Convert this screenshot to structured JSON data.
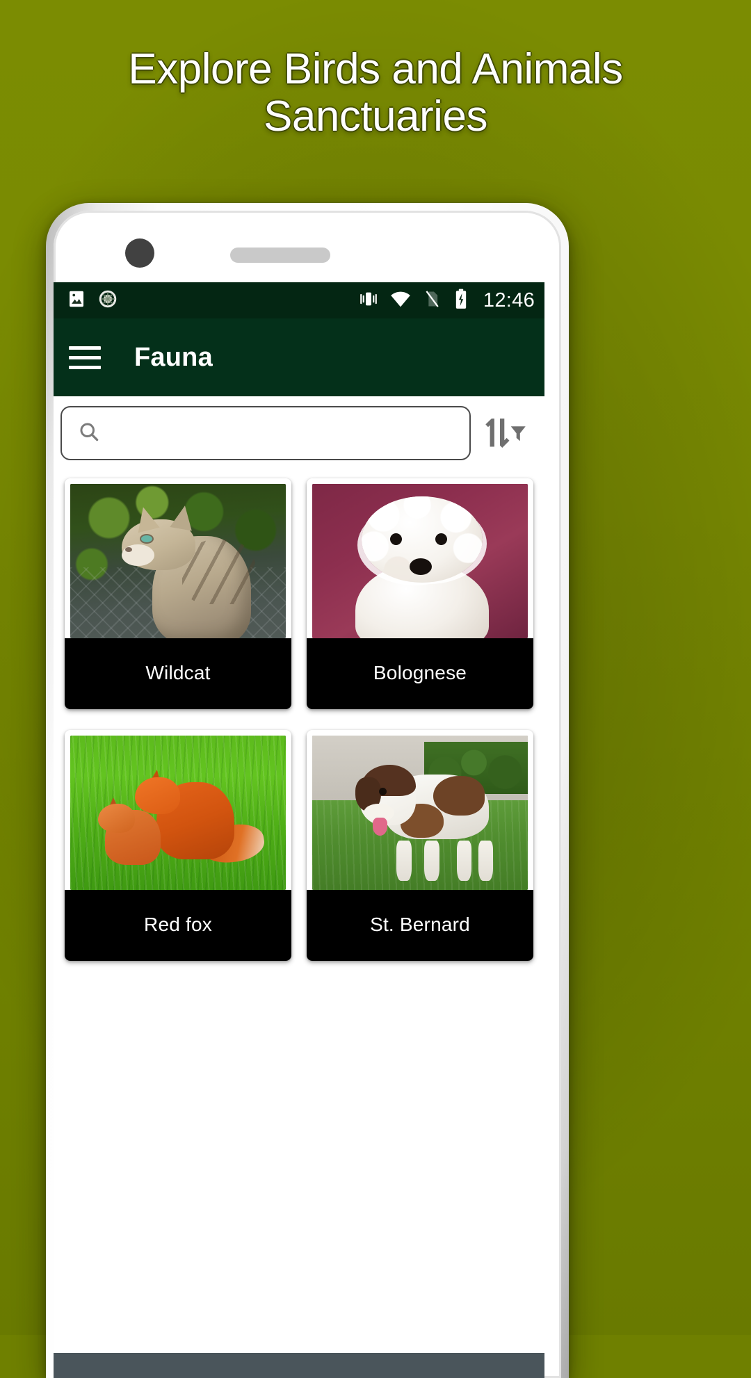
{
  "promo": {
    "headline": "Explore Birds and Animals\nSanctuaries",
    "background_color": "#6f8000",
    "headline_color": "#ffffff"
  },
  "status_bar": {
    "background_color": "#042613",
    "clock": "12:46",
    "left_icons": [
      "image-icon",
      "sync-progress-icon"
    ],
    "right_icons": [
      "vibrate-icon",
      "wifi-icon",
      "no-sim-icon",
      "battery-charging-icon"
    ]
  },
  "app_bar": {
    "background_color": "#04301a",
    "menu_icon": "hamburger-menu-icon",
    "title": "Fauna"
  },
  "search": {
    "value": "",
    "placeholder": "",
    "icon": "search-icon",
    "sort_filter_icon": "sort-filter-icon"
  },
  "grid": {
    "cards": [
      {
        "label": "Wildcat",
        "art": "wildcat"
      },
      {
        "label": "Bolognese",
        "art": "bolognese"
      },
      {
        "label": "Red fox",
        "art": "redfox"
      },
      {
        "label": "St. Bernard",
        "art": "stbernard"
      }
    ]
  },
  "bottom_strip": {
    "color": "#4a555b"
  }
}
